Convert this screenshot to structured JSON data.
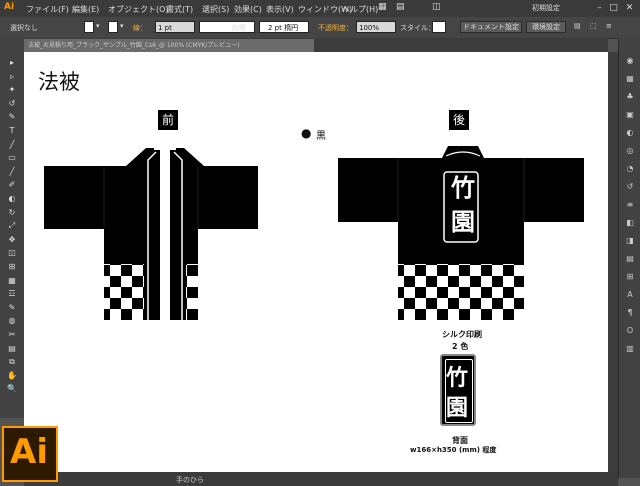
{
  "app": {
    "logo": "Ai",
    "workspace": "初期設定"
  },
  "menu": [
    "ファイル(F)",
    "編集(E)",
    "オブジェクト(O)",
    "書式(T)",
    "選択(S)",
    "効果(C)",
    "表示(V)",
    "ウィンドウ(W)",
    "ヘルプ(H)"
  ],
  "control": {
    "selection": "選択なし",
    "stroke_label": "線：",
    "stroke_weight": "1 pt",
    "stroke_style": "均等",
    "brush": "2 pt 楕円",
    "opacity_label": "不透明度：",
    "opacity_value": "100%",
    "style_label": "スタイル：",
    "doc_settings": "ドキュメント設定",
    "prefs": "環境設定"
  },
  "tab": {
    "title": "法被_お見積り用_ブラック_サンプル_竹園_Cs6_@ 100% (CMYK/プレビュー)"
  },
  "toolbox": [
    "▸",
    "▹",
    "✦",
    "↺",
    "✎",
    "T",
    "╱",
    "▭",
    "╱",
    "✐",
    "◐",
    "↻",
    "⤢",
    "✥",
    "◫",
    "⊞",
    "▦",
    "☲",
    "✎",
    "◍",
    "✂",
    "▤",
    "⧉",
    "✋",
    "🔍"
  ],
  "dock": [
    "◉",
    "▦",
    "♣",
    "▣",
    "◐",
    "◎",
    "◔",
    "↺",
    "≡",
    "◧",
    "◨",
    "▤",
    "⊞",
    "A",
    "¶",
    "O",
    "▥"
  ],
  "artboard": {
    "title": "法被",
    "front_label": "前",
    "back_label": "後",
    "color_dot": "●",
    "color_name": "黒",
    "back_print_top": "竹",
    "back_print_bottom": "園",
    "spec_title": "シルク印刷",
    "spec_colors": "2 色",
    "spec_position": "背面",
    "spec_size": "w166×h350 (mm) 程度"
  },
  "status": {
    "tool": "手のひら"
  }
}
